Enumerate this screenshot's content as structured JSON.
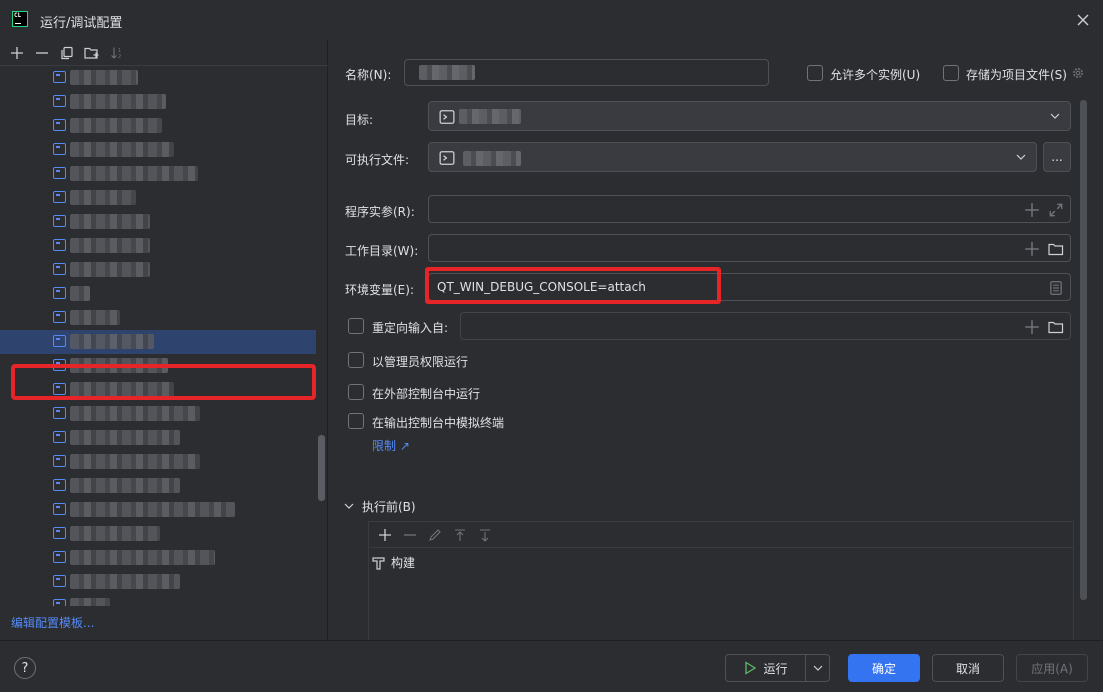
{
  "window": {
    "title": "运行/调试配置"
  },
  "tree": {
    "edit_templates_link": "编辑配置模板...",
    "blur_widths": [
      68,
      96,
      92,
      104,
      128,
      66,
      80,
      80,
      80,
      20,
      50,
      84,
      98,
      104,
      130,
      110,
      130,
      110,
      165,
      90,
      145,
      110,
      40
    ]
  },
  "form": {
    "name_label": "名称(N):",
    "allow_multiple_label": "允许多个实例(U)",
    "store_as_project_label": "存储为项目文件(S)",
    "target_label": "目标:",
    "executable_label": "可执行文件:",
    "more_button_label": "...",
    "program_args_label": "程序实参(R):",
    "working_dir_label": "工作目录(W):",
    "env_vars_label": "环境变量(E):",
    "env_vars_value": "QT_WIN_DEBUG_CONSOLE=attach",
    "redirect_input_label": "重定向输入自:",
    "run_as_admin_label": "以管理员权限运行",
    "run_in_external_console_label": "在外部控制台中运行",
    "emulate_terminal_label": "在输出控制台中模拟终端",
    "limit_link": "限制 ↗"
  },
  "before_launch": {
    "title": "执行前(B)",
    "items": [
      {
        "label": "构建"
      }
    ]
  },
  "footer": {
    "help": "?",
    "run_label": "运行",
    "ok_label": "确定",
    "cancel_label": "取消",
    "apply_label": "应用(A)"
  },
  "colors": {
    "background": "#2b2d30",
    "accent": "#3574f0",
    "link": "#548af7",
    "selected_row": "#2e436e",
    "highlight_red": "#e52527"
  }
}
